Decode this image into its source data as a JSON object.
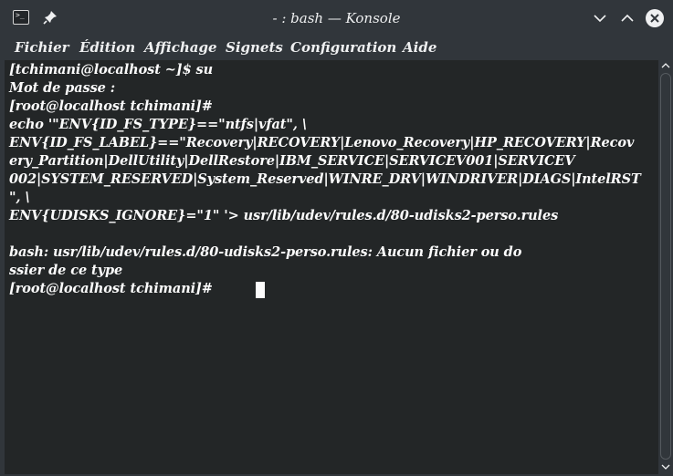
{
  "window": {
    "title": "- : bash — Konsole",
    "app_icon_glyph": ">_",
    "icons": {
      "app": "terminal-icon",
      "pin": "pin-icon",
      "minimize": "chevron-down-icon",
      "maximize": "chevron-up-icon",
      "close": "close-icon"
    }
  },
  "menubar": {
    "items": [
      "Fichier",
      "Édition",
      "Affichage",
      "Signets",
      "Configuration",
      "Aide"
    ]
  },
  "terminal": {
    "lines": [
      "[tchimani@localhost ~]$ su",
      "Mot de passe :",
      "[root@localhost tchimani]#",
      "echo '\"ENV{ID_FS_TYPE}==\"ntfs|vfat\", \\",
      "ENV{ID_FS_LABEL}==\"Recovery|RECOVERY|Lenovo_Recovery|HP_RECOVERY|Recov",
      "ery_Partition|DellUtility|DellRestore|IBM_SERVICE|SERVICEV001|SERVICEV",
      "002|SYSTEM_RESERVED|System_Reserved|WINRE_DRV|WINDRIVER|DIAGS|IntelRST",
      "\", \\",
      "ENV{UDISKS_IGNORE}=\"1\" '> usr/lib/udev/rules.d/80-udisks2-perso.rules",
      "",
      "bash: usr/lib/udev/rules.d/80-udisks2-perso.rules: Aucun fichier ou do",
      "ssier de ce type",
      "[root@localhost tchimani]#"
    ]
  },
  "colors": {
    "chrome": "#31363b",
    "terminal_bg": "#232627",
    "terminal_fg": "#fcfcfc"
  }
}
